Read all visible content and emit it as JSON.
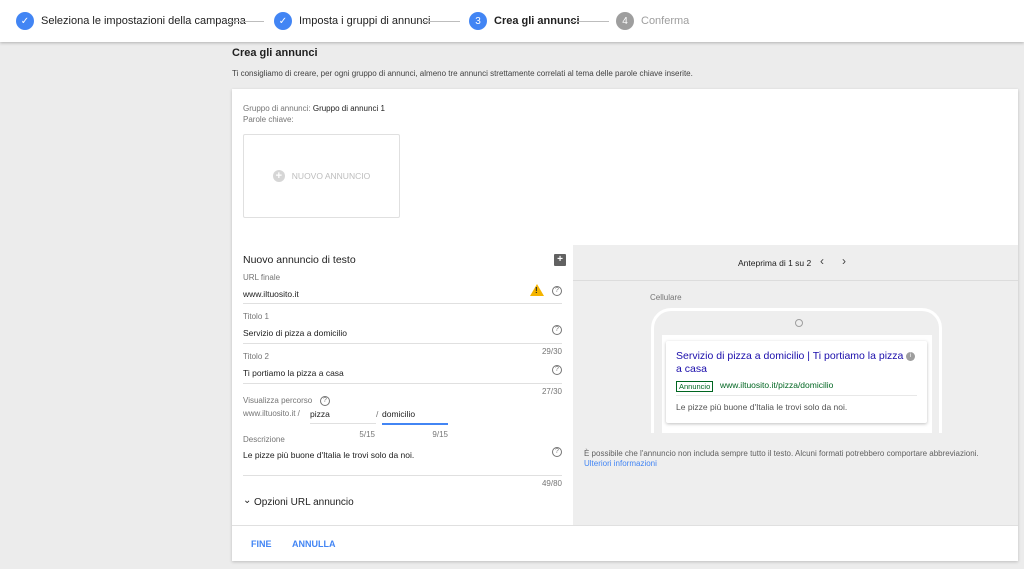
{
  "stepper": {
    "steps": [
      {
        "label": "Seleziona le impostazioni della campagna",
        "state": "done"
      },
      {
        "label": "Imposta i gruppi di annunci",
        "state": "done"
      },
      {
        "label": "Crea gli annunci",
        "number": "3",
        "state": "active"
      },
      {
        "label": "Conferma",
        "number": "4",
        "state": "todo"
      }
    ]
  },
  "page": {
    "title": "Crea gli annunci",
    "subtitle": "Ti consigliamo di creare, per ogni gruppo di annunci, almeno tre annunci strettamente correlati al tema delle parole chiave inserite."
  },
  "ad_group": {
    "label": "Gruppo di annunci:",
    "name": "Gruppo di annunci 1",
    "keywords_label": "Parole chiave:",
    "new_ad_label": "NUOVO ANNUNCIO"
  },
  "form": {
    "title": "Nuovo annuncio di testo",
    "final_url": {
      "label": "URL finale",
      "value": "www.iltuosito.it"
    },
    "headline1": {
      "label": "Titolo 1",
      "value": "Servizio di pizza a domicilio",
      "counter": "29/30"
    },
    "headline2": {
      "label": "Titolo 2",
      "value": "Ti portiamo la pizza a casa",
      "counter": "27/30"
    },
    "display_path": {
      "label": "Visualizza percorso",
      "domain": "www.iltuosito.it /",
      "path1": "pizza",
      "separator": "/",
      "path2": "domicilio",
      "counter1": "5/15",
      "counter2": "9/15"
    },
    "description": {
      "label": "Descrizione",
      "value": "Le pizze più buone d'Italia le trovi solo da noi.",
      "counter": "49/80"
    },
    "url_options_label": "Opzioni URL annuncio"
  },
  "actions": {
    "done": "FINE",
    "cancel": "ANNULLA"
  },
  "preview": {
    "title": "Anteprima di 1 su 2",
    "device": "Cellulare",
    "ad": {
      "headline": "Servizio di pizza a domicilio | Ti portiamo la pizza a casa",
      "badge": "Annuncio",
      "url": "www.iltuosito.it/pizza/domicilio",
      "description": "Le pizze più buone d'Italia le trovi solo da noi."
    },
    "note": "È possibile che l'annuncio non includa sempre tutto il testo. Alcuni formati potrebbero comportare abbreviazioni.",
    "link": "Ulteriori informazioni"
  },
  "colors": {
    "accent": "#4285f4",
    "warning": "#f4b400",
    "ad_url": "#006621",
    "ad_headline": "#1a0dab"
  }
}
